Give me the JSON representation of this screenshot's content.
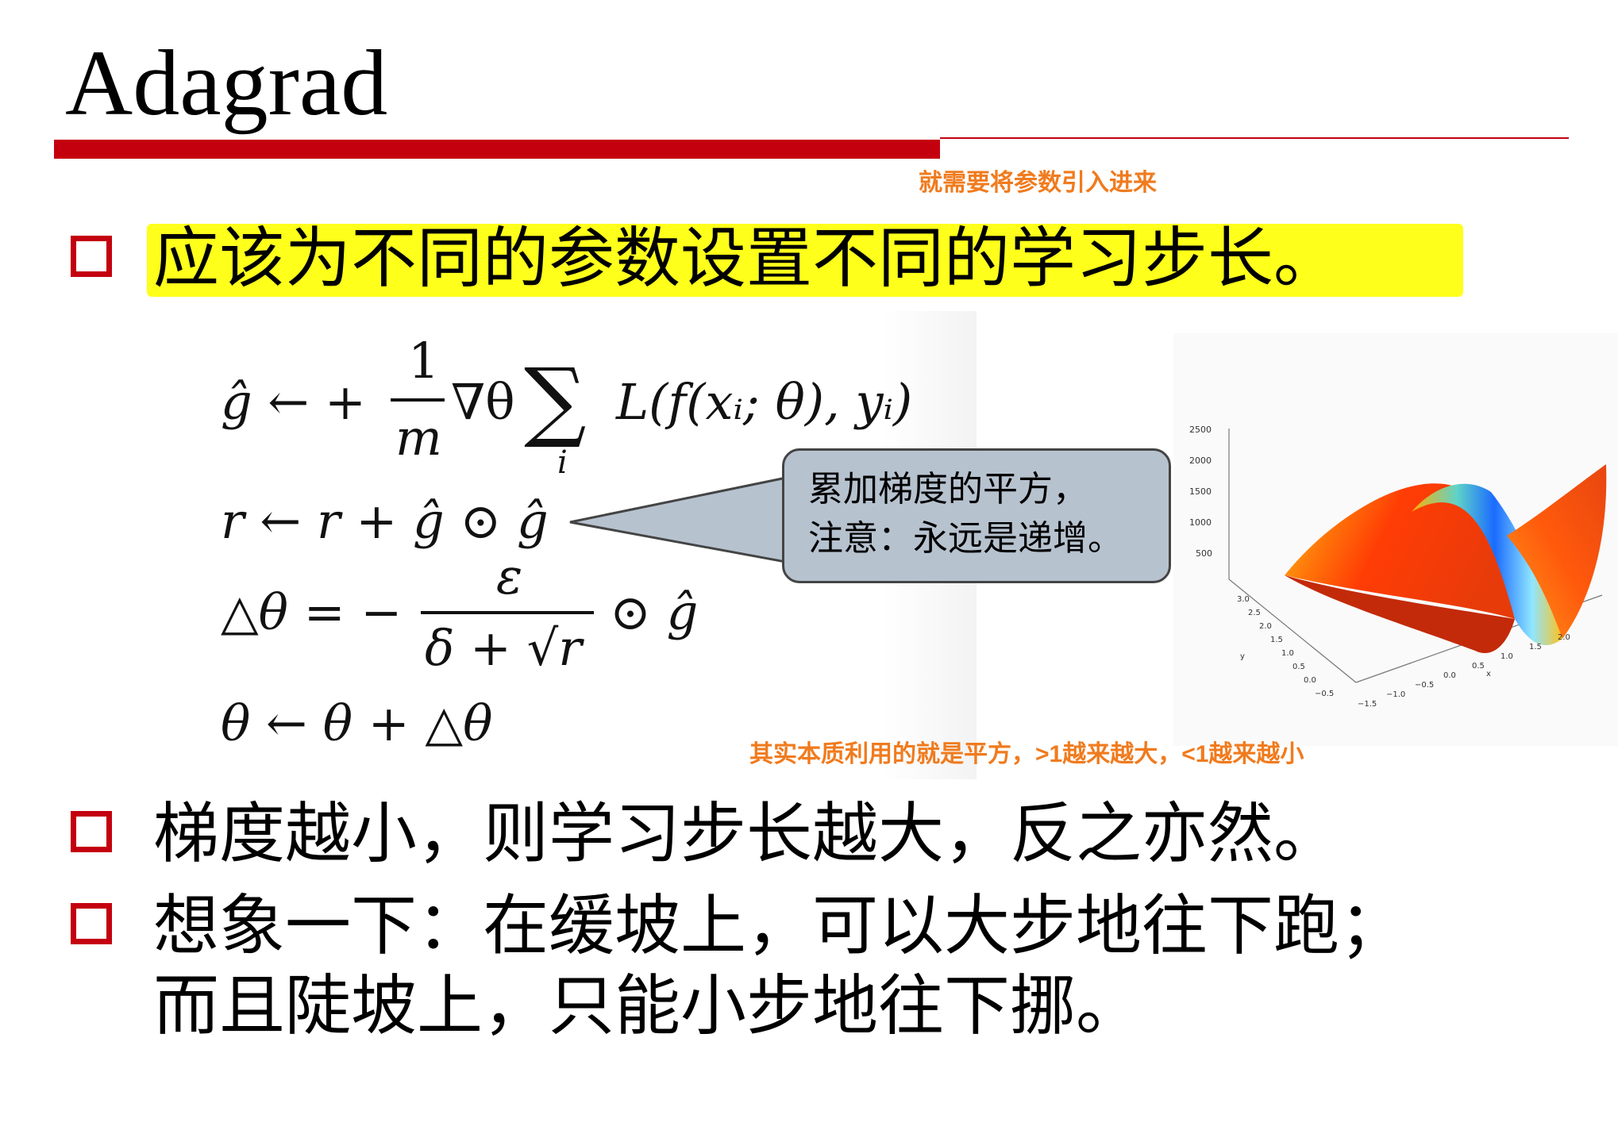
{
  "slide": {
    "title": "Adagrad",
    "top_note": "就需要将参数引入进来",
    "bullets": [
      "应该为不同的参数设置不同的学习步长。",
      "梯度越小，则学习步长越大，反之亦然。",
      "想象一下：在缓坡上，可以大步地往下跑；",
      "而且陡坡上，只能小步地往下挪。"
    ],
    "callout": {
      "line1": "累加梯度的平方，",
      "line2": "注意：永远是递增。"
    },
    "bottom_note": "其实本质利用的就是平方，>1越来越大，<1越来越小",
    "equations": {
      "eq1_lhs": "ĝ ← +",
      "eq1_num": "1",
      "eq1_den": "m",
      "eq1_grad": "∇θ",
      "eq1_sum": "∑",
      "eq1_sub": "i",
      "eq1_rhs": "L(f(xᵢ; θ), yᵢ)",
      "eq2": "r ← r + ĝ ⊙ ĝ",
      "eq3_lhs": "△θ = −",
      "eq3_num": "ε",
      "eq3_den": "δ + √r",
      "eq3_rhs": "⊙ ĝ",
      "eq4": "θ ← θ + △θ"
    },
    "plot": {
      "z_ticks": [
        "2500",
        "2000",
        "1500",
        "1000",
        "500"
      ],
      "y_ticks": [
        "3.0",
        "2.5",
        "2.0",
        "1.5",
        "1.0",
        "0.5",
        "0.0",
        "−0.5"
      ],
      "y_label": "y",
      "x_ticks": [
        "−1.5",
        "−1.0",
        "−0.5",
        "0.0",
        "0.5",
        "1.0",
        "1.5",
        "2.0"
      ],
      "x_label": "x"
    },
    "colors": {
      "accent_red": "#c4000f",
      "note_orange": "#f07b1e",
      "highlight_yellow": "#ffff1c",
      "callout_fill": "#b7c2cf"
    }
  }
}
